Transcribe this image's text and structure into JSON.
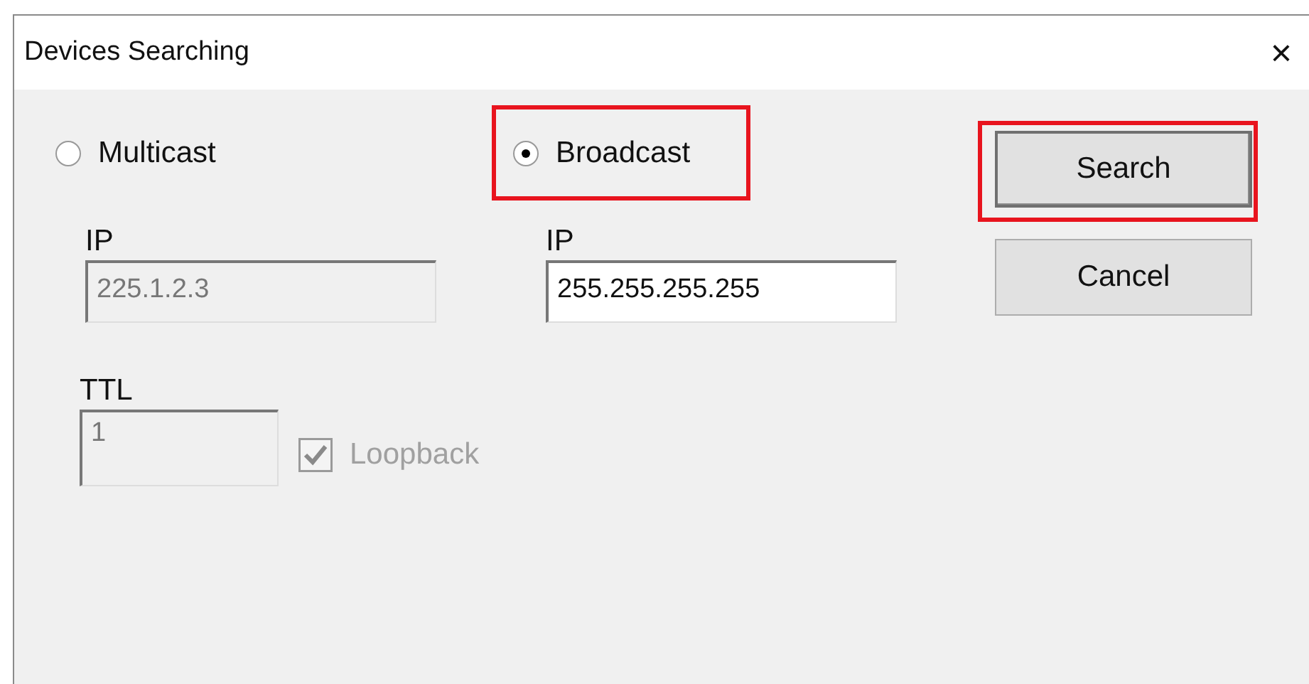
{
  "window": {
    "title": "Devices Searching",
    "close": "×"
  },
  "modes": [
    {
      "label": "Multicast",
      "selected": false,
      "highlighted": false,
      "ip_label": "IP",
      "ip": "225.1.2.3",
      "ttl_label": "TTL",
      "ttl": "1",
      "loopback": {
        "label": "Loopback",
        "checked": true
      }
    },
    {
      "label": "Broadcast",
      "selected": true,
      "highlighted": true,
      "ip_label": "IP",
      "ip": "255.255.255.255"
    }
  ],
  "buttons": [
    {
      "label": "Search",
      "highlighted": true,
      "default": true
    },
    {
      "label": "Cancel",
      "highlighted": false,
      "default": false
    }
  ]
}
